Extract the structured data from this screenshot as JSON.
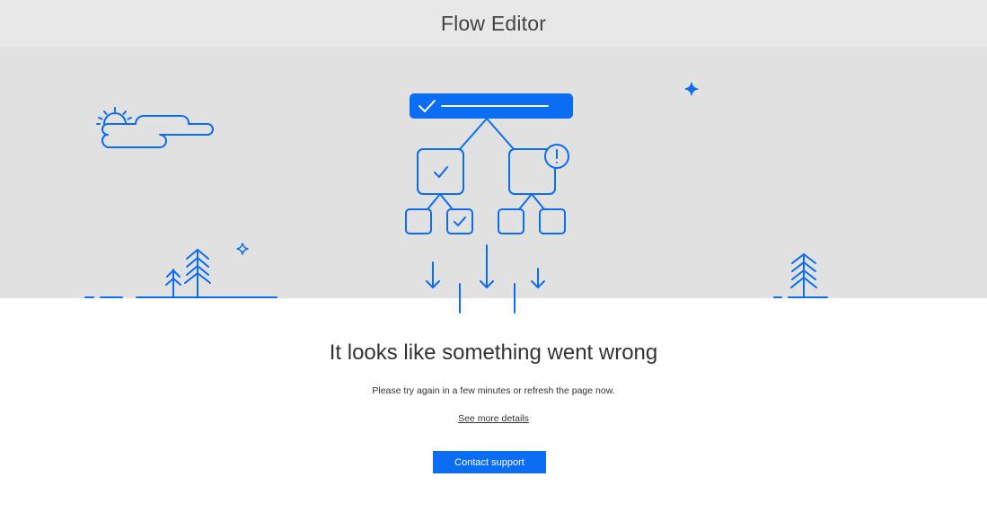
{
  "header": {
    "title": "Flow Editor"
  },
  "illustration": {
    "accent_color": "#0b6cf4",
    "background_color": "#e1e1e1",
    "icons": [
      "sun-icon",
      "cloud-icon",
      "sparkle-icon",
      "flow-diagram-icon",
      "check-icon",
      "warning-icon",
      "tree-icon",
      "arrow-down-icon"
    ]
  },
  "error": {
    "title": "It looks like something went wrong",
    "message": "Please try again in a few minutes or refresh the page now.",
    "details_link": "See more details"
  },
  "actions": {
    "contact_support": "Contact support",
    "button_color": "#0b6cf4"
  }
}
